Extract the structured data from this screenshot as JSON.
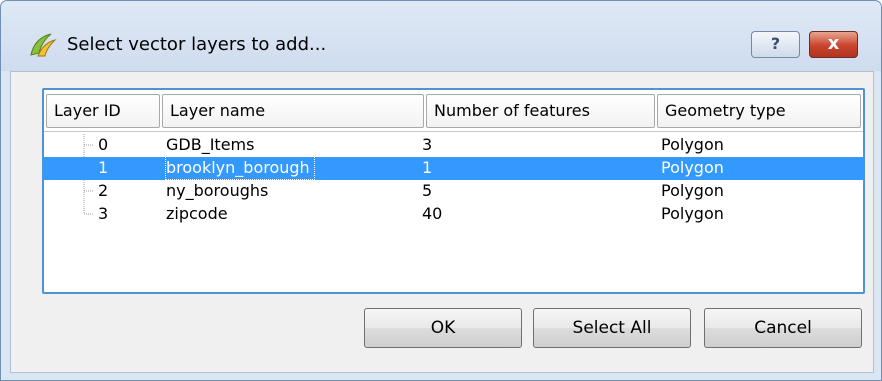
{
  "window": {
    "title": "Select vector layers to add...",
    "help_label": "?",
    "close_label": "x"
  },
  "table": {
    "columns": [
      "Layer ID",
      "Layer name",
      "Number of features",
      "Geometry type"
    ],
    "rows": [
      {
        "id": "0",
        "name": "GDB_Items",
        "features": "3",
        "geometry": "Polygon",
        "selected": false
      },
      {
        "id": "1",
        "name": "brooklyn_borough",
        "features": "1",
        "geometry": "Polygon",
        "selected": true
      },
      {
        "id": "2",
        "name": "ny_boroughs",
        "features": "5",
        "geometry": "Polygon",
        "selected": false
      },
      {
        "id": "3",
        "name": "zipcode",
        "features": "40",
        "geometry": "Polygon",
        "selected": false
      }
    ]
  },
  "buttons": {
    "ok": "OK",
    "select_all": "Select All",
    "cancel": "Cancel"
  },
  "colors": {
    "selection": "#3399ff",
    "table_border": "#4e93d7",
    "title_bg": "#dbe6f3"
  }
}
